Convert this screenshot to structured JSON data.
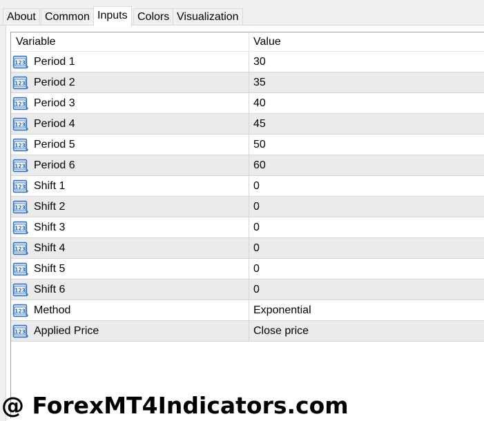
{
  "tabs": [
    {
      "label": "About",
      "active": false
    },
    {
      "label": "Common",
      "active": false
    },
    {
      "label": "Inputs",
      "active": true
    },
    {
      "label": "Colors",
      "active": false
    },
    {
      "label": "Visualization",
      "active": false
    }
  ],
  "table": {
    "columns": [
      "Variable",
      "Value"
    ],
    "row_icon": "numeric-123-icon",
    "rows": [
      {
        "variable": "Period 1",
        "value": "30"
      },
      {
        "variable": "Period 2",
        "value": "35"
      },
      {
        "variable": "Period 3",
        "value": "40"
      },
      {
        "variable": "Period 4",
        "value": "45"
      },
      {
        "variable": "Period 5",
        "value": "50"
      },
      {
        "variable": "Period 6",
        "value": "60"
      },
      {
        "variable": "Shift 1",
        "value": "0"
      },
      {
        "variable": "Shift 2",
        "value": "0"
      },
      {
        "variable": "Shift 3",
        "value": "0"
      },
      {
        "variable": "Shift 4",
        "value": "0"
      },
      {
        "variable": "Shift 5",
        "value": "0"
      },
      {
        "variable": "Shift 6",
        "value": "0"
      },
      {
        "variable": "Method",
        "value": "Exponential"
      },
      {
        "variable": "Applied Price",
        "value": "Close price"
      }
    ]
  },
  "watermark": "@ ForexMT4Indicators.com",
  "colors": {
    "row_alt": "#ebebeb",
    "icon_blue": "#2f6fc2",
    "icon_light": "#cfe3f7"
  }
}
